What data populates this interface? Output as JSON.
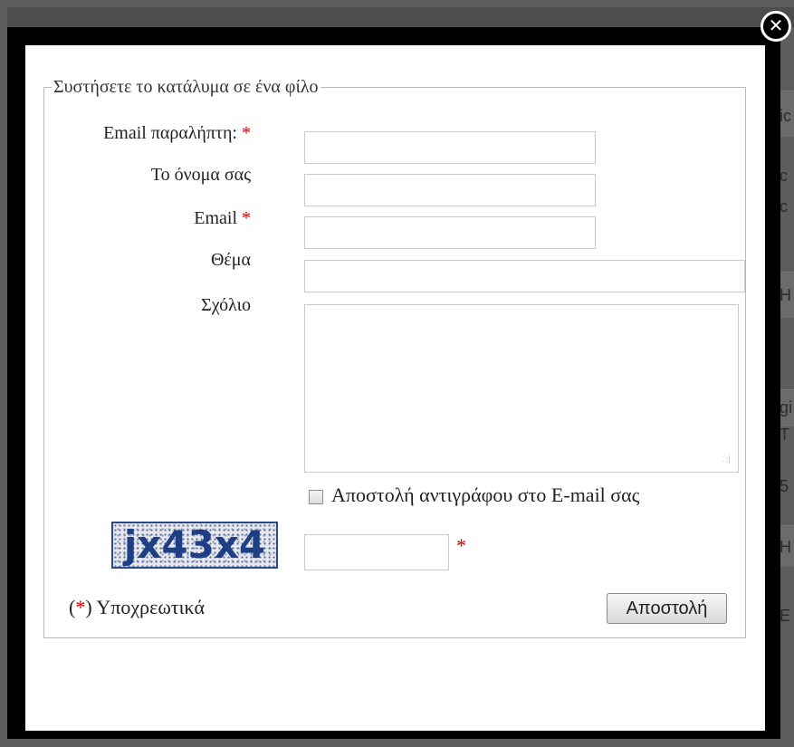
{
  "background_fragments": [
    "ic",
    "c",
    "c",
    "H",
    "gi",
    "T",
    "5",
    "H",
    "E"
  ],
  "close_button": {
    "icon": "close-icon",
    "glyph": "✕"
  },
  "form": {
    "legend": "Συστήσετε το κατάλυμα σε ένα φίλο",
    "required_mark": "*",
    "fields": {
      "recipient_email": {
        "label": "Email παραλήπτη:",
        "value": ""
      },
      "your_name": {
        "label": "Το όνομα σας",
        "value": ""
      },
      "email": {
        "label": "Email",
        "value": ""
      },
      "subject": {
        "label": "Θέμα",
        "value": ""
      },
      "comment": {
        "label": "Σχόλιο",
        "value": ""
      }
    },
    "copy_checkbox": {
      "label": "Αποστολή αντιγράφου στο E-mail σας",
      "checked": false
    },
    "captcha": {
      "text": "jx43x4",
      "value": ""
    },
    "required_note_open": "(",
    "required_note_close": ") Υποχρεωτικά",
    "submit_label": "Αποστολή"
  },
  "colors": {
    "required_star": "#d10000",
    "captcha_text": "#1f3f85",
    "modal_frame": "#000000"
  }
}
